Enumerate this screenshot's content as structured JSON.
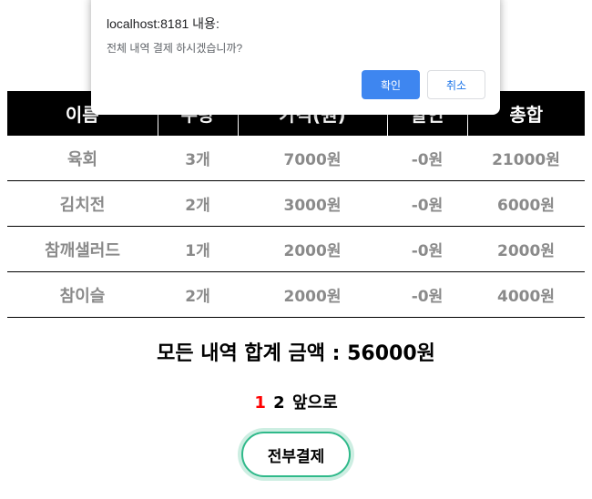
{
  "table": {
    "headers": [
      "이름",
      "수량",
      "가격(원)",
      "할인",
      "총합"
    ],
    "rows": [
      {
        "name": "육회",
        "qty": "3개",
        "price": "7000원",
        "discount": "-0원",
        "total": "21000원"
      },
      {
        "name": "김치전",
        "qty": "2개",
        "price": "3000원",
        "discount": "-0원",
        "total": "6000원"
      },
      {
        "name": "참깨샐러드",
        "qty": "1개",
        "price": "2000원",
        "discount": "-0원",
        "total": "2000원"
      },
      {
        "name": "참이슬",
        "qty": "2개",
        "price": "2000원",
        "discount": "-0원",
        "total": "4000원"
      }
    ]
  },
  "summary": {
    "total_text": "모든 내역 합계 금액 : 56000원"
  },
  "pager": {
    "page1": "1",
    "page2": "2",
    "next": "앞으로"
  },
  "pay_button": {
    "label": "전부결제"
  },
  "dialog": {
    "title": "localhost:8181 내용:",
    "message": "전체 내역 결제 하시겠습니까?",
    "ok_label": "확인",
    "cancel_label": "취소"
  }
}
